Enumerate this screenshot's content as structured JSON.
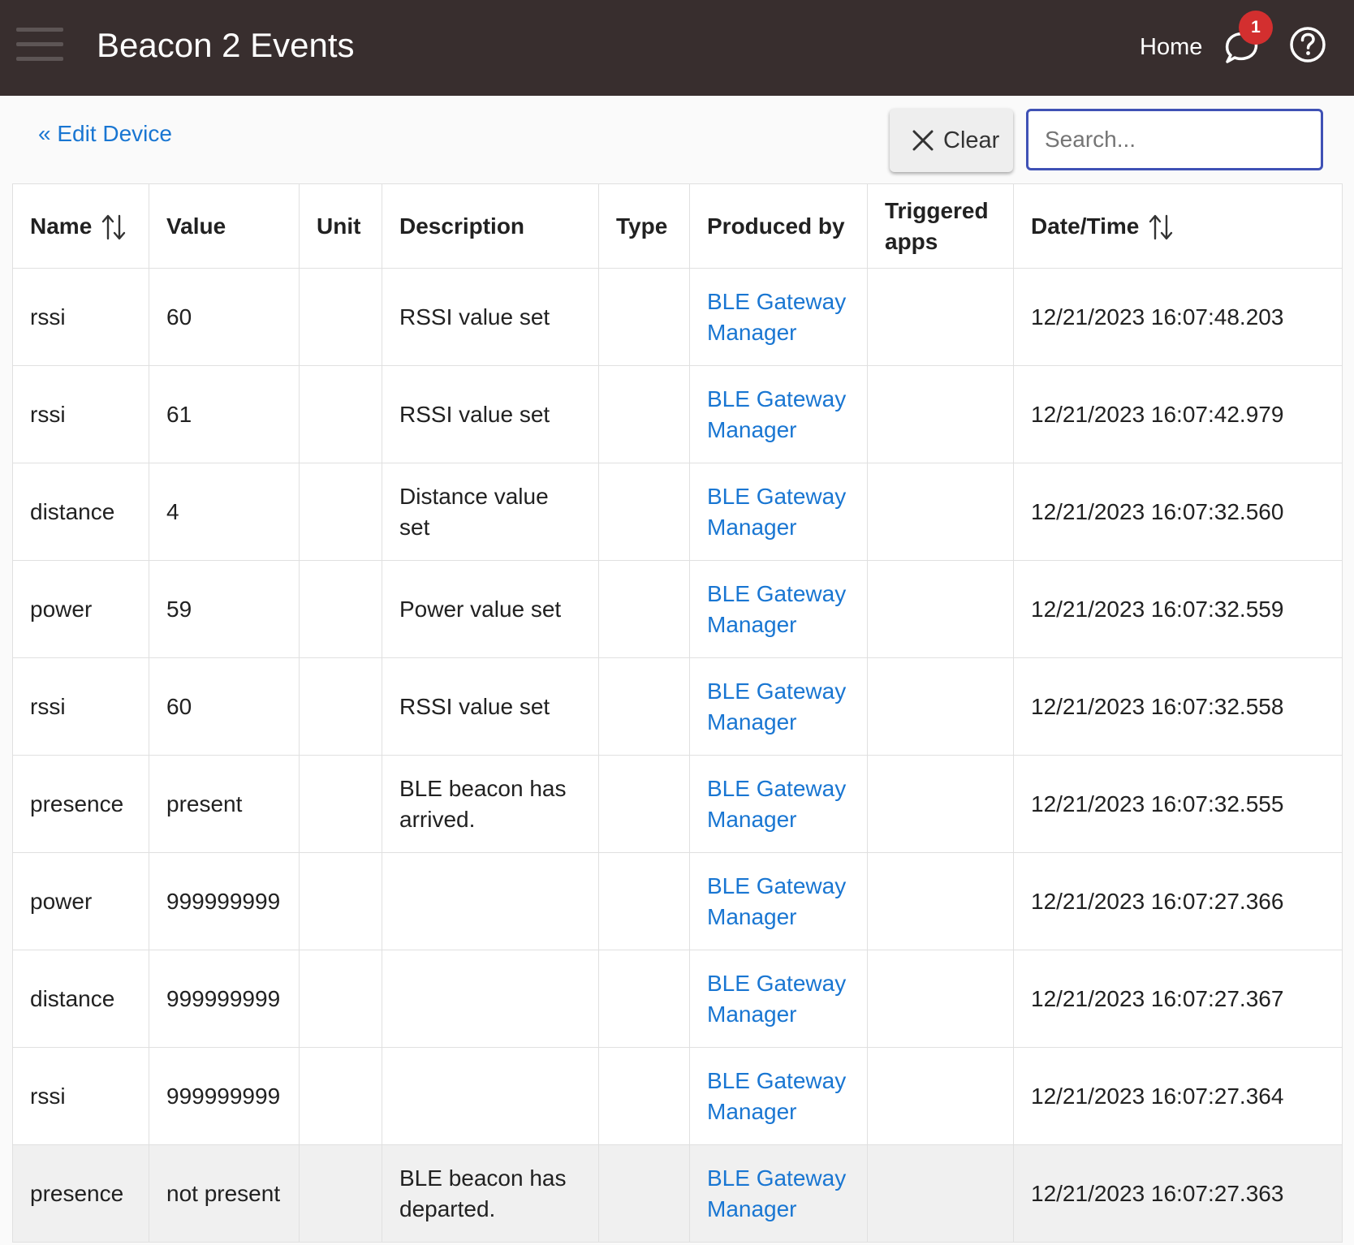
{
  "header": {
    "title": "Beacon 2 Events",
    "home_label": "Home",
    "notification_count": "1",
    "colors": {
      "bar": "#382e2e",
      "badge": "#d32f2f"
    }
  },
  "toolbar": {
    "back_label": "« Edit Device",
    "clear_label": "Clear",
    "search_placeholder": "Search...",
    "search_value": ""
  },
  "table": {
    "columns": [
      "Name",
      "Value",
      "Unit",
      "Description",
      "Type",
      "Produced by",
      "Triggered apps",
      "Date/Time"
    ],
    "rows": [
      {
        "name": "rssi",
        "value": "60",
        "unit": "",
        "description": "RSSI value set",
        "type": "",
        "produced_by": "BLE Gateway Manager",
        "triggered_apps": "",
        "datetime": "12/21/2023 16:07:48.203"
      },
      {
        "name": "rssi",
        "value": "61",
        "unit": "",
        "description": "RSSI value set",
        "type": "",
        "produced_by": "BLE Gateway Manager",
        "triggered_apps": "",
        "datetime": "12/21/2023 16:07:42.979"
      },
      {
        "name": "distance",
        "value": "4",
        "unit": "",
        "description": "Distance value set",
        "type": "",
        "produced_by": "BLE Gateway Manager",
        "triggered_apps": "",
        "datetime": "12/21/2023 16:07:32.560"
      },
      {
        "name": "power",
        "value": "59",
        "unit": "",
        "description": "Power value set",
        "type": "",
        "produced_by": "BLE Gateway Manager",
        "triggered_apps": "",
        "datetime": "12/21/2023 16:07:32.559"
      },
      {
        "name": "rssi",
        "value": "60",
        "unit": "",
        "description": "RSSI value set",
        "type": "",
        "produced_by": "BLE Gateway Manager",
        "triggered_apps": "",
        "datetime": "12/21/2023 16:07:32.558"
      },
      {
        "name": "presence",
        "value": "present",
        "unit": "",
        "description": "BLE beacon has arrived.",
        "type": "",
        "produced_by": "BLE Gateway Manager",
        "triggered_apps": "",
        "datetime": "12/21/2023 16:07:32.555"
      },
      {
        "name": "power",
        "value": "999999999",
        "unit": "",
        "description": "",
        "type": "",
        "produced_by": "BLE Gateway Manager",
        "triggered_apps": "",
        "datetime": "12/21/2023 16:07:27.366"
      },
      {
        "name": "distance",
        "value": "999999999",
        "unit": "",
        "description": "",
        "type": "",
        "produced_by": "BLE Gateway Manager",
        "triggered_apps": "",
        "datetime": "12/21/2023 16:07:27.367"
      },
      {
        "name": "rssi",
        "value": "999999999",
        "unit": "",
        "description": "",
        "type": "",
        "produced_by": "BLE Gateway Manager",
        "triggered_apps": "",
        "datetime": "12/21/2023 16:07:27.364"
      },
      {
        "name": "presence",
        "value": "not present",
        "unit": "",
        "description": "BLE beacon has departed.",
        "type": "",
        "produced_by": "BLE Gateway Manager",
        "triggered_apps": "",
        "datetime": "12/21/2023 16:07:27.363"
      }
    ]
  },
  "icons": {
    "menu": "hamburger-menu-icon",
    "notifications": "chat-bubble-icon",
    "help": "help-circle-icon",
    "clear": "close-icon",
    "sort": "sort-arrows-icon"
  }
}
